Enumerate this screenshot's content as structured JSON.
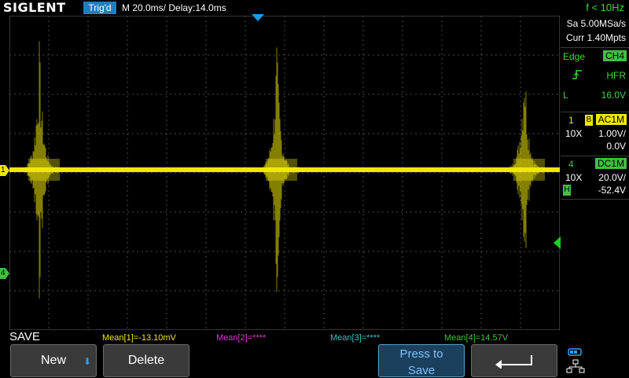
{
  "top": {
    "logo": "SIGLENT",
    "trigger_state": "Trig'd",
    "timebase": "M 20.0ms/ Delay:14.0ms",
    "frequency": "f < 10Hz"
  },
  "right_panel": {
    "sample_rate": "Sa 5.00MSa/s",
    "memory_depth": "Curr 1.40Mpts",
    "trigger": {
      "type": "Edge",
      "source": "CH4",
      "coupling": "HFR",
      "slope_icon": "rising-edge-icon",
      "level_label": "L",
      "level": "16.0V"
    },
    "channel1": {
      "number": "1",
      "bw_flag": "B",
      "coupling": "AC1M",
      "probe": "10X",
      "scale": "1.00V/",
      "offset": "0.0V"
    },
    "channel4": {
      "number": "4",
      "coupling": "DC1M",
      "probe": "10X",
      "scale": "20.0V/",
      "flag": "H",
      "offset": "-52.4V"
    }
  },
  "markers": {
    "ch1": "1",
    "ch4": "4"
  },
  "measurements": {
    "menu_title": "SAVE",
    "m1": "Mean[1]=-13.10mV",
    "m2": "Mean[2]=****",
    "m3": "Mean[3]=****",
    "m4": "Mean[4]=14.57V"
  },
  "softkeys": {
    "new": "New",
    "delete": "Delete",
    "press_to_save_line1": "Press to",
    "press_to_save_line2": "Save",
    "back_icon": "back-arrow-icon"
  },
  "colors": {
    "ch1": "#f0e800",
    "ch2": "#d040d0",
    "ch3": "#40c0c0",
    "ch4": "#40c040",
    "accent": "#1e7fc0"
  }
}
